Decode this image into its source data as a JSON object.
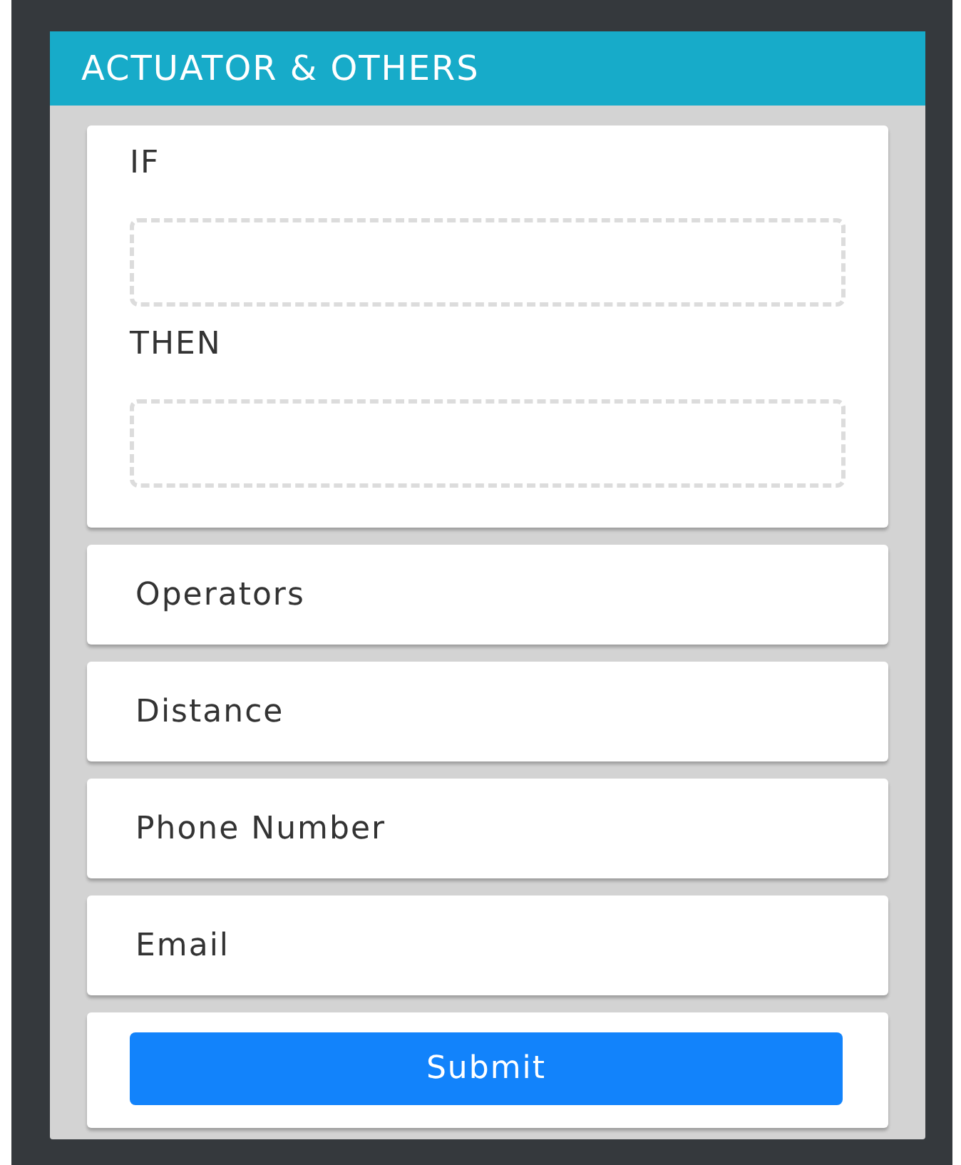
{
  "panel": {
    "title": "ACTUATOR & OTHERS"
  },
  "rule": [
    {
      "label": "IF"
    },
    {
      "label": "THEN"
    }
  ],
  "blocks": [
    {
      "label": "Operators"
    },
    {
      "label": "Distance"
    },
    {
      "label": "Phone Number"
    },
    {
      "label": "Email"
    }
  ],
  "submit": {
    "label": "Submit"
  }
}
